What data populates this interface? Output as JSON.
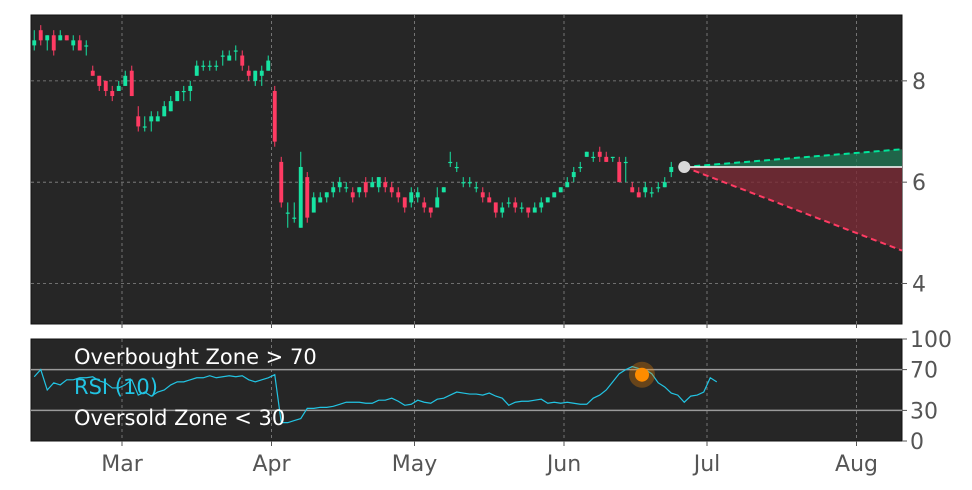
{
  "chart_data": [
    {
      "type": "candlestick",
      "title": "",
      "xlabel": "",
      "ylabel": "",
      "ylim": [
        3.2,
        9.3
      ],
      "yticks": [
        4,
        6,
        8
      ],
      "grid": true,
      "background": "#262626",
      "colors": {
        "up": "#17e3a2",
        "down": "#ff3b63",
        "upper_band": "#00e59a",
        "lower_band": "#ff3b63",
        "current": "#d9d9d9"
      },
      "current_price": 6.3,
      "projection": {
        "start": 6.3,
        "upper_end": 6.65,
        "lower_end": 4.65,
        "base": 6.3
      },
      "candles": [
        [
          8.7,
          9.0,
          8.6,
          8.8
        ],
        [
          9.0,
          9.1,
          8.7,
          8.8
        ],
        [
          8.8,
          8.9,
          8.6,
          8.9
        ],
        [
          8.9,
          9.0,
          8.5,
          8.6
        ],
        [
          8.8,
          9.0,
          8.8,
          8.9
        ],
        [
          8.9,
          8.9,
          8.8,
          8.8
        ],
        [
          8.7,
          8.9,
          8.6,
          8.8
        ],
        [
          8.8,
          8.9,
          8.6,
          8.6
        ],
        [
          8.7,
          8.8,
          8.5,
          8.7
        ],
        [
          8.2,
          8.3,
          8.1,
          8.1
        ],
        [
          8.1,
          8.1,
          7.8,
          7.9
        ],
        [
          8.0,
          8.0,
          7.7,
          7.8
        ],
        [
          7.8,
          7.9,
          7.6,
          7.7
        ],
        [
          7.8,
          8.0,
          7.8,
          7.9
        ],
        [
          7.9,
          8.2,
          7.9,
          8.1
        ],
        [
          8.2,
          8.3,
          7.7,
          7.7
        ],
        [
          7.3,
          7.5,
          7.0,
          7.1
        ],
        [
          7.1,
          7.3,
          7.0,
          7.1
        ],
        [
          7.2,
          7.4,
          7.0,
          7.3
        ],
        [
          7.2,
          7.4,
          7.2,
          7.3
        ],
        [
          7.3,
          7.6,
          7.3,
          7.5
        ],
        [
          7.4,
          7.7,
          7.4,
          7.6
        ],
        [
          7.6,
          7.8,
          7.6,
          7.8
        ],
        [
          7.8,
          7.9,
          7.6,
          7.8
        ],
        [
          7.8,
          8.0,
          7.6,
          7.9
        ],
        [
          8.1,
          8.4,
          8.1,
          8.3
        ],
        [
          8.3,
          8.4,
          8.2,
          8.3
        ],
        [
          8.3,
          8.4,
          8.2,
          8.3
        ],
        [
          8.3,
          8.4,
          8.2,
          8.3
        ],
        [
          8.5,
          8.6,
          8.3,
          8.5
        ],
        [
          8.4,
          8.6,
          8.4,
          8.5
        ],
        [
          8.6,
          8.7,
          8.4,
          8.6
        ],
        [
          8.5,
          8.6,
          8.2,
          8.3
        ],
        [
          8.2,
          8.3,
          8.0,
          8.1
        ],
        [
          8.0,
          8.2,
          7.9,
          8.2
        ],
        [
          8.1,
          8.3,
          7.9,
          8.2
        ],
        [
          8.2,
          8.5,
          8.2,
          8.4
        ],
        [
          7.8,
          7.9,
          6.7,
          6.8
        ],
        [
          6.4,
          6.5,
          5.5,
          5.6
        ],
        [
          5.4,
          5.6,
          5.1,
          5.4
        ],
        [
          5.3,
          5.6,
          5.2,
          5.3
        ],
        [
          5.1,
          6.6,
          5.1,
          6.3
        ],
        [
          6.1,
          6.2,
          5.2,
          5.3
        ],
        [
          5.4,
          5.8,
          5.4,
          5.7
        ],
        [
          5.6,
          5.8,
          5.6,
          5.7
        ],
        [
          5.7,
          5.8,
          5.6,
          5.8
        ],
        [
          5.8,
          6.0,
          5.7,
          5.9
        ],
        [
          5.9,
          6.1,
          5.8,
          6.0
        ],
        [
          5.9,
          6.0,
          5.8,
          5.9
        ],
        [
          5.8,
          5.9,
          5.6,
          5.7
        ],
        [
          5.8,
          5.9,
          5.7,
          5.9
        ],
        [
          6.0,
          6.1,
          5.7,
          5.8
        ],
        [
          5.9,
          6.1,
          5.9,
          6.0
        ],
        [
          5.9,
          6.1,
          5.8,
          6.1
        ],
        [
          6.0,
          6.1,
          5.8,
          5.9
        ],
        [
          5.9,
          6.0,
          5.7,
          5.8
        ],
        [
          5.8,
          5.9,
          5.6,
          5.7
        ],
        [
          5.7,
          5.7,
          5.4,
          5.5
        ],
        [
          5.6,
          5.9,
          5.5,
          5.8
        ],
        [
          5.7,
          5.9,
          5.6,
          5.8
        ],
        [
          5.6,
          5.7,
          5.4,
          5.5
        ],
        [
          5.5,
          5.5,
          5.3,
          5.4
        ],
        [
          5.5,
          5.9,
          5.5,
          5.7
        ],
        [
          5.8,
          5.9,
          5.8,
          5.9
        ],
        [
          6.4,
          6.6,
          6.3,
          6.4
        ],
        [
          6.3,
          6.4,
          6.2,
          6.3
        ],
        [
          6.0,
          6.1,
          5.9,
          6.0
        ],
        [
          6.0,
          6.1,
          5.9,
          6.0
        ],
        [
          5.9,
          6.0,
          5.8,
          5.9
        ],
        [
          5.8,
          5.9,
          5.6,
          5.7
        ],
        [
          5.7,
          5.8,
          5.6,
          5.6
        ],
        [
          5.6,
          5.6,
          5.3,
          5.4
        ],
        [
          5.4,
          5.6,
          5.3,
          5.5
        ],
        [
          5.6,
          5.7,
          5.5,
          5.6
        ],
        [
          5.6,
          5.7,
          5.4,
          5.5
        ],
        [
          5.5,
          5.6,
          5.4,
          5.5
        ],
        [
          5.5,
          5.5,
          5.3,
          5.4
        ],
        [
          5.4,
          5.6,
          5.4,
          5.5
        ],
        [
          5.5,
          5.7,
          5.4,
          5.6
        ],
        [
          5.6,
          5.7,
          5.6,
          5.7
        ],
        [
          5.7,
          5.8,
          5.7,
          5.8
        ],
        [
          5.8,
          5.9,
          5.8,
          5.9
        ],
        [
          5.9,
          6.1,
          5.9,
          6.0
        ],
        [
          6.1,
          6.3,
          6.0,
          6.2
        ],
        [
          6.3,
          6.4,
          6.2,
          6.3
        ],
        [
          6.5,
          6.6,
          6.5,
          6.6
        ],
        [
          6.5,
          6.6,
          6.4,
          6.5
        ],
        [
          6.6,
          6.7,
          6.4,
          6.5
        ],
        [
          6.5,
          6.6,
          6.4,
          6.4
        ],
        [
          6.5,
          6.5,
          6.4,
          6.5
        ],
        [
          6.4,
          6.5,
          6.1,
          6.0
        ],
        [
          6.4,
          6.5,
          6.0,
          6.4
        ],
        [
          5.9,
          6.0,
          5.8,
          5.8
        ],
        [
          5.8,
          5.9,
          5.7,
          5.7
        ],
        [
          5.8,
          6.0,
          5.7,
          5.9
        ],
        [
          5.8,
          5.9,
          5.7,
          5.8
        ],
        [
          5.9,
          6.0,
          5.8,
          5.9
        ],
        [
          5.9,
          6.1,
          5.9,
          6.0
        ],
        [
          6.2,
          6.4,
          6.1,
          6.3
        ]
      ],
      "x_range": [
        0,
        134
      ],
      "month_ticks": [
        {
          "label": "Mar",
          "pos": 14
        },
        {
          "label": "Apr",
          "pos": 37
        },
        {
          "label": "May",
          "pos": 59
        },
        {
          "label": "Jun",
          "pos": 82
        },
        {
          "label": "Jul",
          "pos": 104
        },
        {
          "label": "Aug",
          "pos": 127
        }
      ]
    },
    {
      "type": "line",
      "title": "",
      "ylim": [
        0,
        100
      ],
      "yticks": [
        0,
        30,
        70,
        100
      ],
      "colors": {
        "line": "#22c4e3",
        "zone": "#9a9a9a",
        "marker": "#ff8c00"
      },
      "labels": {
        "overbought": "Overbought Zone > 70",
        "rsi": "RSI (10)",
        "oversold": "Oversold Zone < 30"
      },
      "overbought": 70,
      "oversold": 30,
      "marker": {
        "x": 94,
        "y": 65
      },
      "values": [
        63,
        70,
        50,
        57,
        55,
        60,
        60,
        62,
        62,
        63,
        59,
        57,
        52,
        52,
        55,
        60,
        45,
        48,
        44,
        48,
        50,
        55,
        58,
        58,
        60,
        62,
        62,
        64,
        62,
        63,
        64,
        63,
        64,
        60,
        58,
        60,
        62,
        65,
        18,
        18,
        20,
        22,
        32,
        32,
        33,
        33,
        34,
        36,
        38,
        38,
        38,
        37,
        37,
        40,
        40,
        42,
        39,
        35,
        36,
        40,
        38,
        37,
        41,
        42,
        45,
        48,
        47,
        46,
        46,
        45,
        47,
        44,
        42,
        35,
        38,
        39,
        39,
        40,
        41,
        37,
        38,
        37,
        38,
        37,
        36,
        36,
        42,
        45,
        50,
        58,
        66,
        70,
        73,
        71,
        70,
        66,
        57,
        53,
        47,
        45,
        38,
        44,
        45,
        48,
        62,
        58
      ],
      "month_ticks": [
        {
          "label": "Mar",
          "pos": 14
        },
        {
          "label": "Apr",
          "pos": 37
        },
        {
          "label": "May",
          "pos": 59
        },
        {
          "label": "Jun",
          "pos": 82
        },
        {
          "label": "Jul",
          "pos": 104
        },
        {
          "label": "Aug",
          "pos": 127
        }
      ]
    }
  ]
}
